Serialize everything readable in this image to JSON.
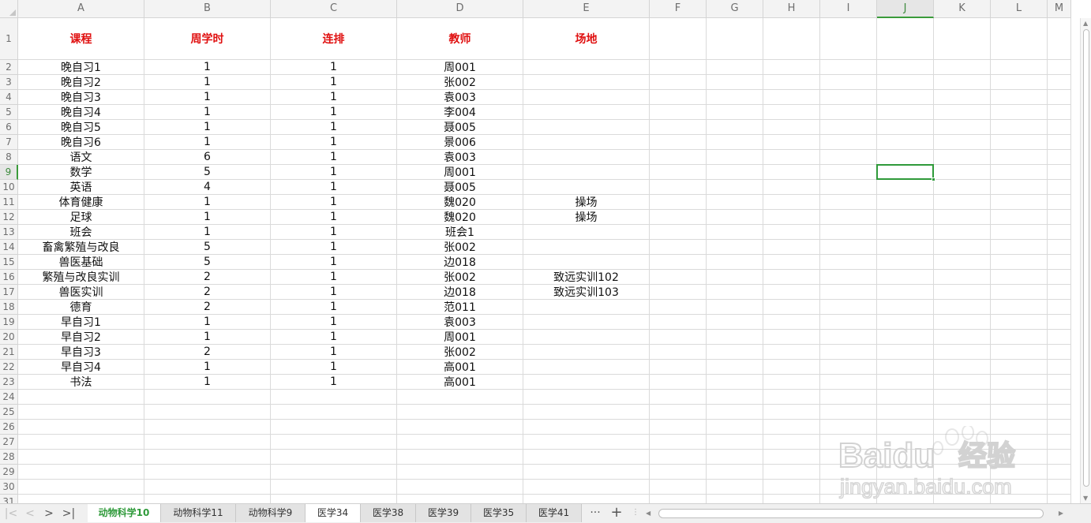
{
  "columns": [
    "A",
    "B",
    "C",
    "D",
    "E",
    "F",
    "G",
    "H",
    "I",
    "J",
    "K",
    "L",
    "M"
  ],
  "active_column": "J",
  "active_row": 9,
  "rows": [
    [
      "课程",
      "周学时",
      "连排",
      "教师",
      "场地"
    ],
    [
      "晚自习1",
      "1",
      "1",
      "周001",
      ""
    ],
    [
      "晚自习2",
      "1",
      "1",
      "张002",
      ""
    ],
    [
      "晚自习3",
      "1",
      "1",
      "袁003",
      ""
    ],
    [
      "晚自习4",
      "1",
      "1",
      "李004",
      ""
    ],
    [
      "晚自习5",
      "1",
      "1",
      "聂005",
      ""
    ],
    [
      "晚自习6",
      "1",
      "1",
      "景006",
      ""
    ],
    [
      "语文",
      "6",
      "1",
      "袁003",
      ""
    ],
    [
      "数学",
      "5",
      "1",
      "周001",
      ""
    ],
    [
      "英语",
      "4",
      "1",
      "聂005",
      ""
    ],
    [
      "体育健康",
      "1",
      "1",
      "魏020",
      "操场"
    ],
    [
      "足球",
      "1",
      "1",
      "魏020",
      "操场"
    ],
    [
      "班会",
      "1",
      "1",
      "班会1",
      ""
    ],
    [
      "畜禽繁殖与改良",
      "5",
      "1",
      "张002",
      ""
    ],
    [
      "兽医基础",
      "5",
      "1",
      "边018",
      ""
    ],
    [
      "繁殖与改良实训",
      "2",
      "1",
      "张002",
      "致远实训102"
    ],
    [
      "兽医实训",
      "2",
      "1",
      "边018",
      "致远实训103"
    ],
    [
      "德育",
      "2",
      "1",
      "范011",
      ""
    ],
    [
      "早自习1",
      "1",
      "1",
      "袁003",
      ""
    ],
    [
      "早自习2",
      "1",
      "1",
      "周001",
      ""
    ],
    [
      "早自习3",
      "2",
      "1",
      "张002",
      ""
    ],
    [
      "早自习4",
      "1",
      "1",
      "高001",
      ""
    ],
    [
      "书法",
      "1",
      "1",
      "高001",
      ""
    ]
  ],
  "row_numbers": [
    "1",
    "2",
    "3",
    "4",
    "5",
    "6",
    "7",
    "8",
    "9",
    "10",
    "11",
    "12",
    "13",
    "14",
    "15",
    "16",
    "17",
    "18",
    "19",
    "20",
    "21",
    "22",
    "23",
    "24",
    "25",
    "26",
    "27",
    "28",
    "29",
    "30",
    "31"
  ],
  "tabs": [
    "动物科学10",
    "动物科学11",
    "动物科学9",
    "医学34",
    "医学38",
    "医学39",
    "医学35",
    "医学41"
  ],
  "active_tab": 0,
  "tab_nav": {
    "first": "|<",
    "prev": "<",
    "next": ">",
    "last": ">|",
    "more": "···",
    "add": "+"
  },
  "watermark": {
    "brand": "Baidu",
    "brand_cn": "经验",
    "url": "jingyan.baidu.com"
  },
  "colors": {
    "header_text": "#e01010",
    "selection": "#2f9a3a",
    "active_tab_text": "#2f9a3a"
  }
}
